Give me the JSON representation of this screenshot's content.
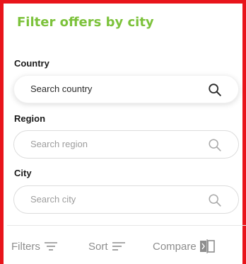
{
  "panel": {
    "title": "Filter offers by city",
    "accent_color": "#7cc23b",
    "border_color": "#e8141b"
  },
  "filters": {
    "country": {
      "label": "Country",
      "placeholder": "Search country",
      "icon": "search-icon"
    },
    "region": {
      "label": "Region",
      "placeholder": "Search region",
      "icon": "search-icon"
    },
    "city": {
      "label": "City",
      "placeholder": "Search city",
      "icon": "search-icon"
    }
  },
  "bottom_bar": {
    "filters_label": "Filters",
    "filters_icon": "filter-lines-icon",
    "sort_label": "Sort",
    "sort_icon": "sort-lines-icon",
    "compare_label": "Compare",
    "compare_icon": "compare-icon"
  }
}
